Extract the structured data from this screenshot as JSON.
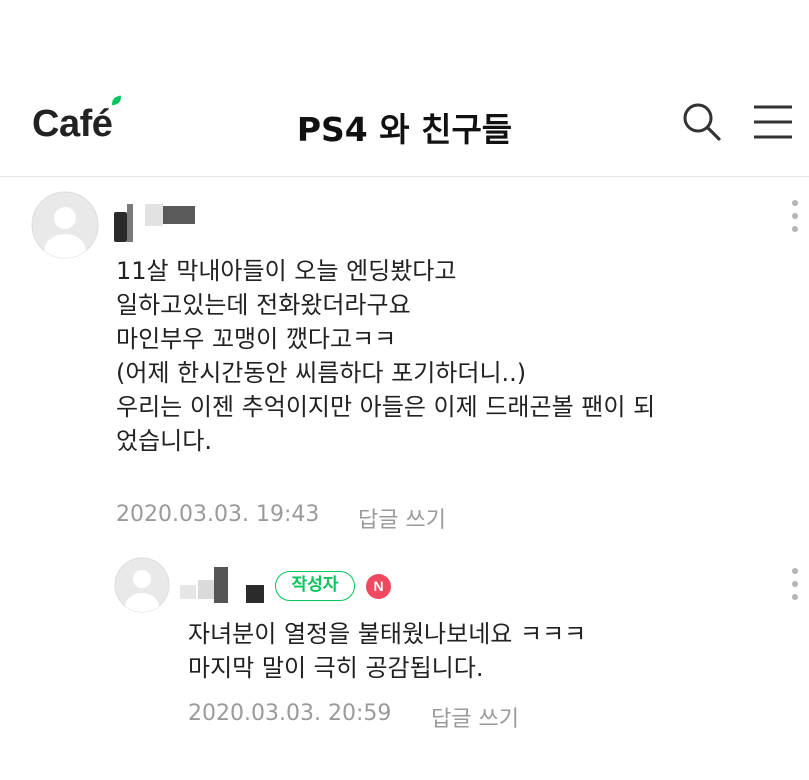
{
  "header": {
    "logo_text": "Café",
    "cafe_name": "PS4 와 친구들",
    "search_icon": "search-icon",
    "menu_icon": "hamburger-menu-icon"
  },
  "colors": {
    "brand_green": "#03c75a",
    "n_badge_red": "#f0485f",
    "meta_gray": "#9a9a9a"
  },
  "comment": {
    "author_hidden": true,
    "lines": [
      "11살 막내아들이 오늘 엔딩봤다고",
      "일하고있는데 전화왔더라구요",
      "마인부우 꼬맹이 깼다고ㅋㅋ",
      "(어제 한시간동안 씨름하다 포기하더니..)",
      "우리는 이젠 추억이지만 아들은 이제 드래곤볼 팬이 되",
      "었습니다."
    ],
    "timestamp": "2020.03.03. 19:43",
    "reply_label": "답글 쓰기"
  },
  "reply": {
    "author_hidden": true,
    "author_badge": "작성자",
    "n_badge": "N",
    "lines": [
      "자녀분이 열정을 불태웠나보네요 ㅋㅋㅋ",
      "마지막 말이 극히 공감됩니다."
    ],
    "timestamp": "2020.03.03. 20:59",
    "reply_label": "답글 쓰기"
  }
}
